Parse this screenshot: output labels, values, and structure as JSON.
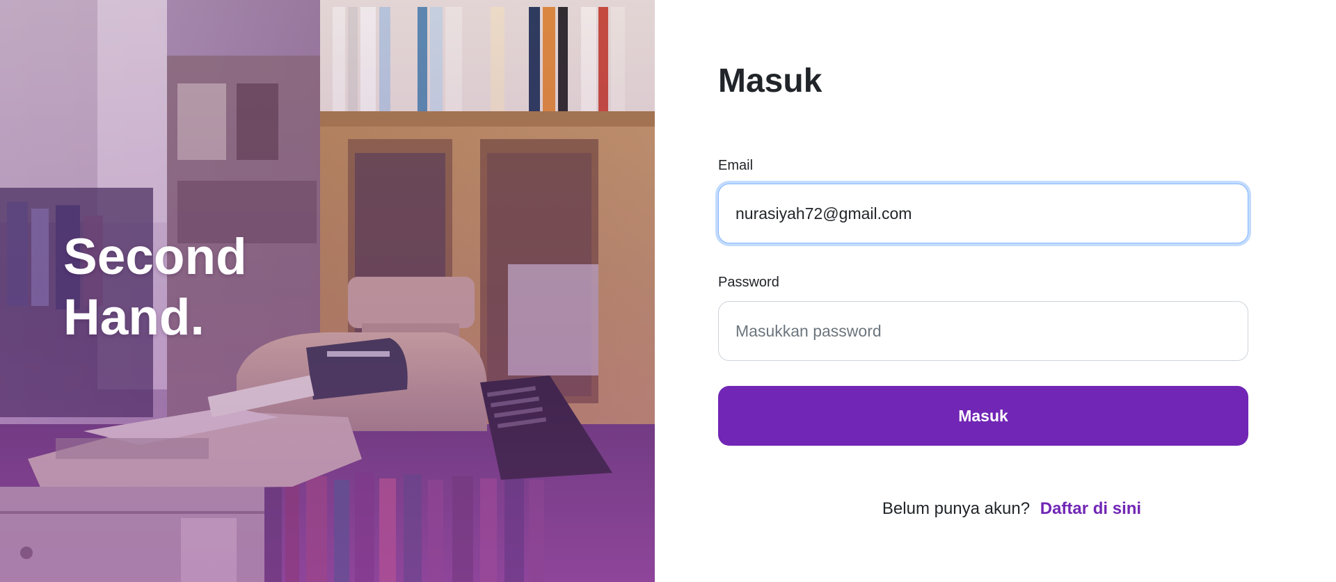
{
  "brand": {
    "line1": "Second",
    "line2": "Hand."
  },
  "login": {
    "title": "Masuk",
    "email_label": "Email",
    "email_value": "nurasiyah72@gmail.com",
    "password_label": "Password",
    "password_placeholder": "Masukkan password",
    "submit_label": "Masuk",
    "signup_prompt": "Belum punya akun?",
    "signup_link": "Daftar di sini"
  },
  "colors": {
    "accent": "#7126b5",
    "focus_ring": "#86b7fe"
  }
}
